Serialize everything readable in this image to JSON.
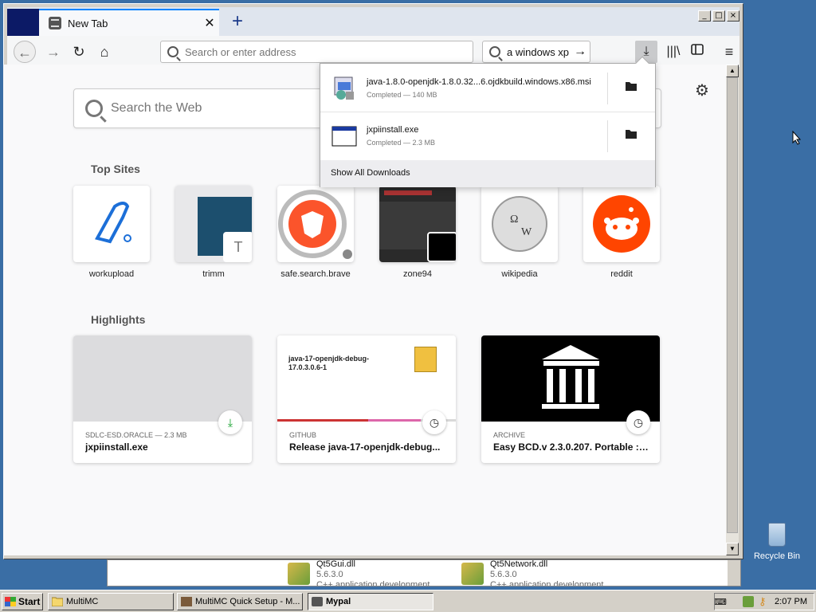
{
  "browser": {
    "tab": {
      "title": "New Tab"
    },
    "new_tab_symbol": "+",
    "close_symbol": "✕",
    "url_placeholder": "Search or enter address",
    "search_value": "a windows xp",
    "search_go": "→",
    "nav": {
      "back": "←",
      "forward": "→",
      "reload": "↻",
      "home": "⌂"
    },
    "toolbar": {
      "library": "|||\\",
      "menu": "≡",
      "downloads": "⤓"
    }
  },
  "newtab": {
    "web_search_placeholder": "Search the Web",
    "settings_symbol": "⚙",
    "top_sites_title": "Top Sites",
    "top_sites": [
      {
        "label": "workupload"
      },
      {
        "label": "trimm",
        "letter": "T"
      },
      {
        "label": "safe.search.brave"
      },
      {
        "label": "zone94"
      },
      {
        "label": "wikipedia"
      },
      {
        "label": "reddit"
      }
    ],
    "highlights_title": "Highlights",
    "highlights": [
      {
        "source": "SDLC-ESD.ORACLE — 2.3 MB",
        "title": "jxpiinstall.exe"
      },
      {
        "source": "GITHUB",
        "title": "Release java-17-openjdk-debug...",
        "preview_title": "java-17-openjdk-debug-17.0.3.0.6-1"
      },
      {
        "source": "ARCHIVE",
        "title": "Easy BCD.v 2.3.0.207. Portable : ..."
      }
    ]
  },
  "downloads": {
    "items": [
      {
        "name": "java-1.8.0-openjdk-1.8.0.32...6.ojdkbuild.windows.x86.msi",
        "status": "Completed — 140 MB"
      },
      {
        "name": "jxpiinstall.exe",
        "status": "Completed — 2.3 MB"
      }
    ],
    "show_all": "Show All Downloads"
  },
  "background_window": {
    "items": [
      {
        "name": "Qt5Gui.dll",
        "version": "5.6.3.0",
        "desc": "C++ application development"
      },
      {
        "name": "Qt5Network.dll",
        "version": "5.6.3.0",
        "desc": "C++ application development"
      }
    ]
  },
  "desktop": {
    "recycle_bin": "Recycle Bin"
  },
  "taskbar": {
    "start": "Start",
    "buttons": [
      {
        "label": "MultiMC"
      },
      {
        "label": "MultiMC Quick Setup - M..."
      },
      {
        "label": "Mypal"
      }
    ],
    "clock": "2:07 PM"
  },
  "colors": {
    "accent": "#0a84ff",
    "desktop": "#3a6ea5",
    "reddit": "#ff4500",
    "brave": "#fb542b",
    "workupload": "#1c6fd8"
  }
}
